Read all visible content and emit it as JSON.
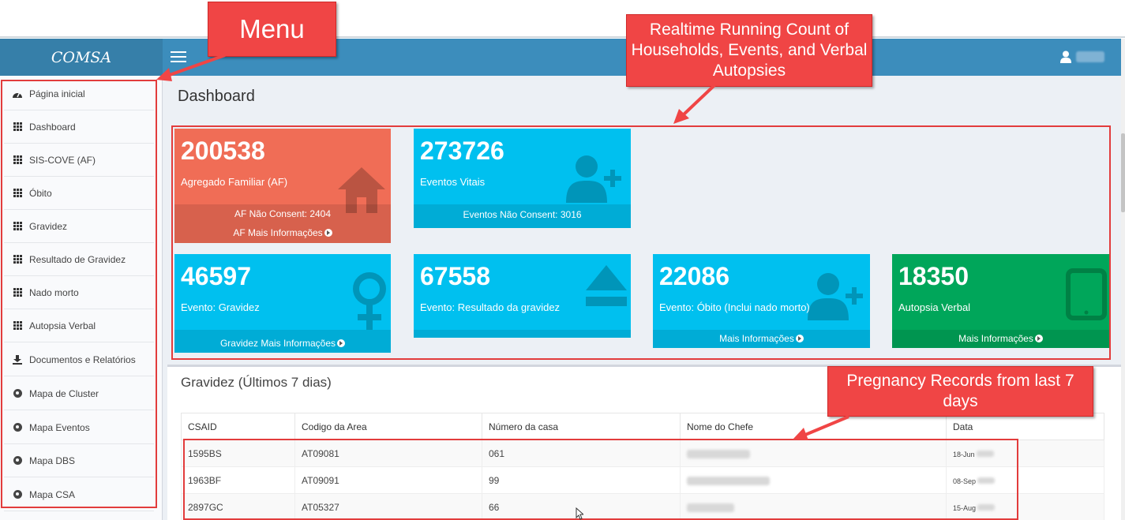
{
  "header": {
    "brand": "COMSA",
    "user_name_redacted": true
  },
  "sidebar": {
    "items": [
      {
        "label": "Página inicial",
        "icon": "dashboard-gauge-icon"
      },
      {
        "label": "Dashboard",
        "icon": "grid-icon"
      },
      {
        "label": "SIS-COVE (AF)",
        "icon": "grid-icon"
      },
      {
        "label": "Óbito",
        "icon": "grid-icon"
      },
      {
        "label": "Gravidez",
        "icon": "grid-icon"
      },
      {
        "label": "Resultado de Gravidez",
        "icon": "grid-icon"
      },
      {
        "label": "Nado morto",
        "icon": "grid-icon"
      },
      {
        "label": "Autopsia Verbal",
        "icon": "grid-icon"
      },
      {
        "label": "Documentos e Relatórios",
        "icon": "download-icon"
      },
      {
        "label": "Mapa de Cluster",
        "icon": "globe-icon"
      },
      {
        "label": "Mapa Eventos",
        "icon": "globe-icon"
      },
      {
        "label": "Mapa DBS",
        "icon": "globe-icon"
      },
      {
        "label": "Mapa CSA",
        "icon": "globe-icon"
      }
    ]
  },
  "main": {
    "title": "Dashboard",
    "boxes": [
      {
        "count": "200538",
        "label": "Agregado Familiar (AF)",
        "footer1": "AF Não Consent: 2404",
        "footer2": "AF Mais Informações",
        "color": "#f06d56",
        "icon": "home-icon"
      },
      {
        "count": "273726",
        "label": "Eventos Vitais",
        "footer1": "Eventos Não Consent: 3016",
        "color": "#00c0ef",
        "icon": "user-plus-icon"
      },
      {
        "count": "46597",
        "label": "Evento: Gravidez",
        "footer1": "Gravidez Mais Informações",
        "color": "#00c0ef",
        "icon": "female-icon"
      },
      {
        "count": "67558",
        "label": "Evento: Resultado da gravidez",
        "color": "#00c0ef",
        "icon": "eject-icon"
      },
      {
        "count": "22086",
        "label": "Evento: Óbito (Inclui nado morto)",
        "footer1": "Mais Informações",
        "color": "#00c0ef",
        "icon": "user-plus-icon"
      },
      {
        "count": "18350",
        "label": "Autopsia Verbal",
        "footer1": "Mais Informações",
        "color": "#00a65a",
        "icon": "tablet-icon"
      }
    ]
  },
  "table": {
    "title": "Gravidez (Últimos 7 dias)",
    "columns": [
      "CSAID",
      "Codigo da Area",
      "Número da casa",
      "Nome do Chefe",
      "Data"
    ],
    "rows": [
      {
        "csaid": "1595BS",
        "area": "AT09081",
        "casa": "061",
        "data": "18-Jun"
      },
      {
        "csaid": "1963BF",
        "area": "AT09091",
        "casa": "99",
        "data": "08-Sep"
      },
      {
        "csaid": "2897GC",
        "area": "AT05327",
        "casa": "66",
        "data": "15-Aug"
      }
    ]
  },
  "annotations": {
    "menu": "Menu",
    "counts": "Realtime Running Count of Households, Events, and Verbal Autopsies",
    "pregnancy": "Pregnancy Records from last 7 days",
    "color": "#f04545"
  }
}
